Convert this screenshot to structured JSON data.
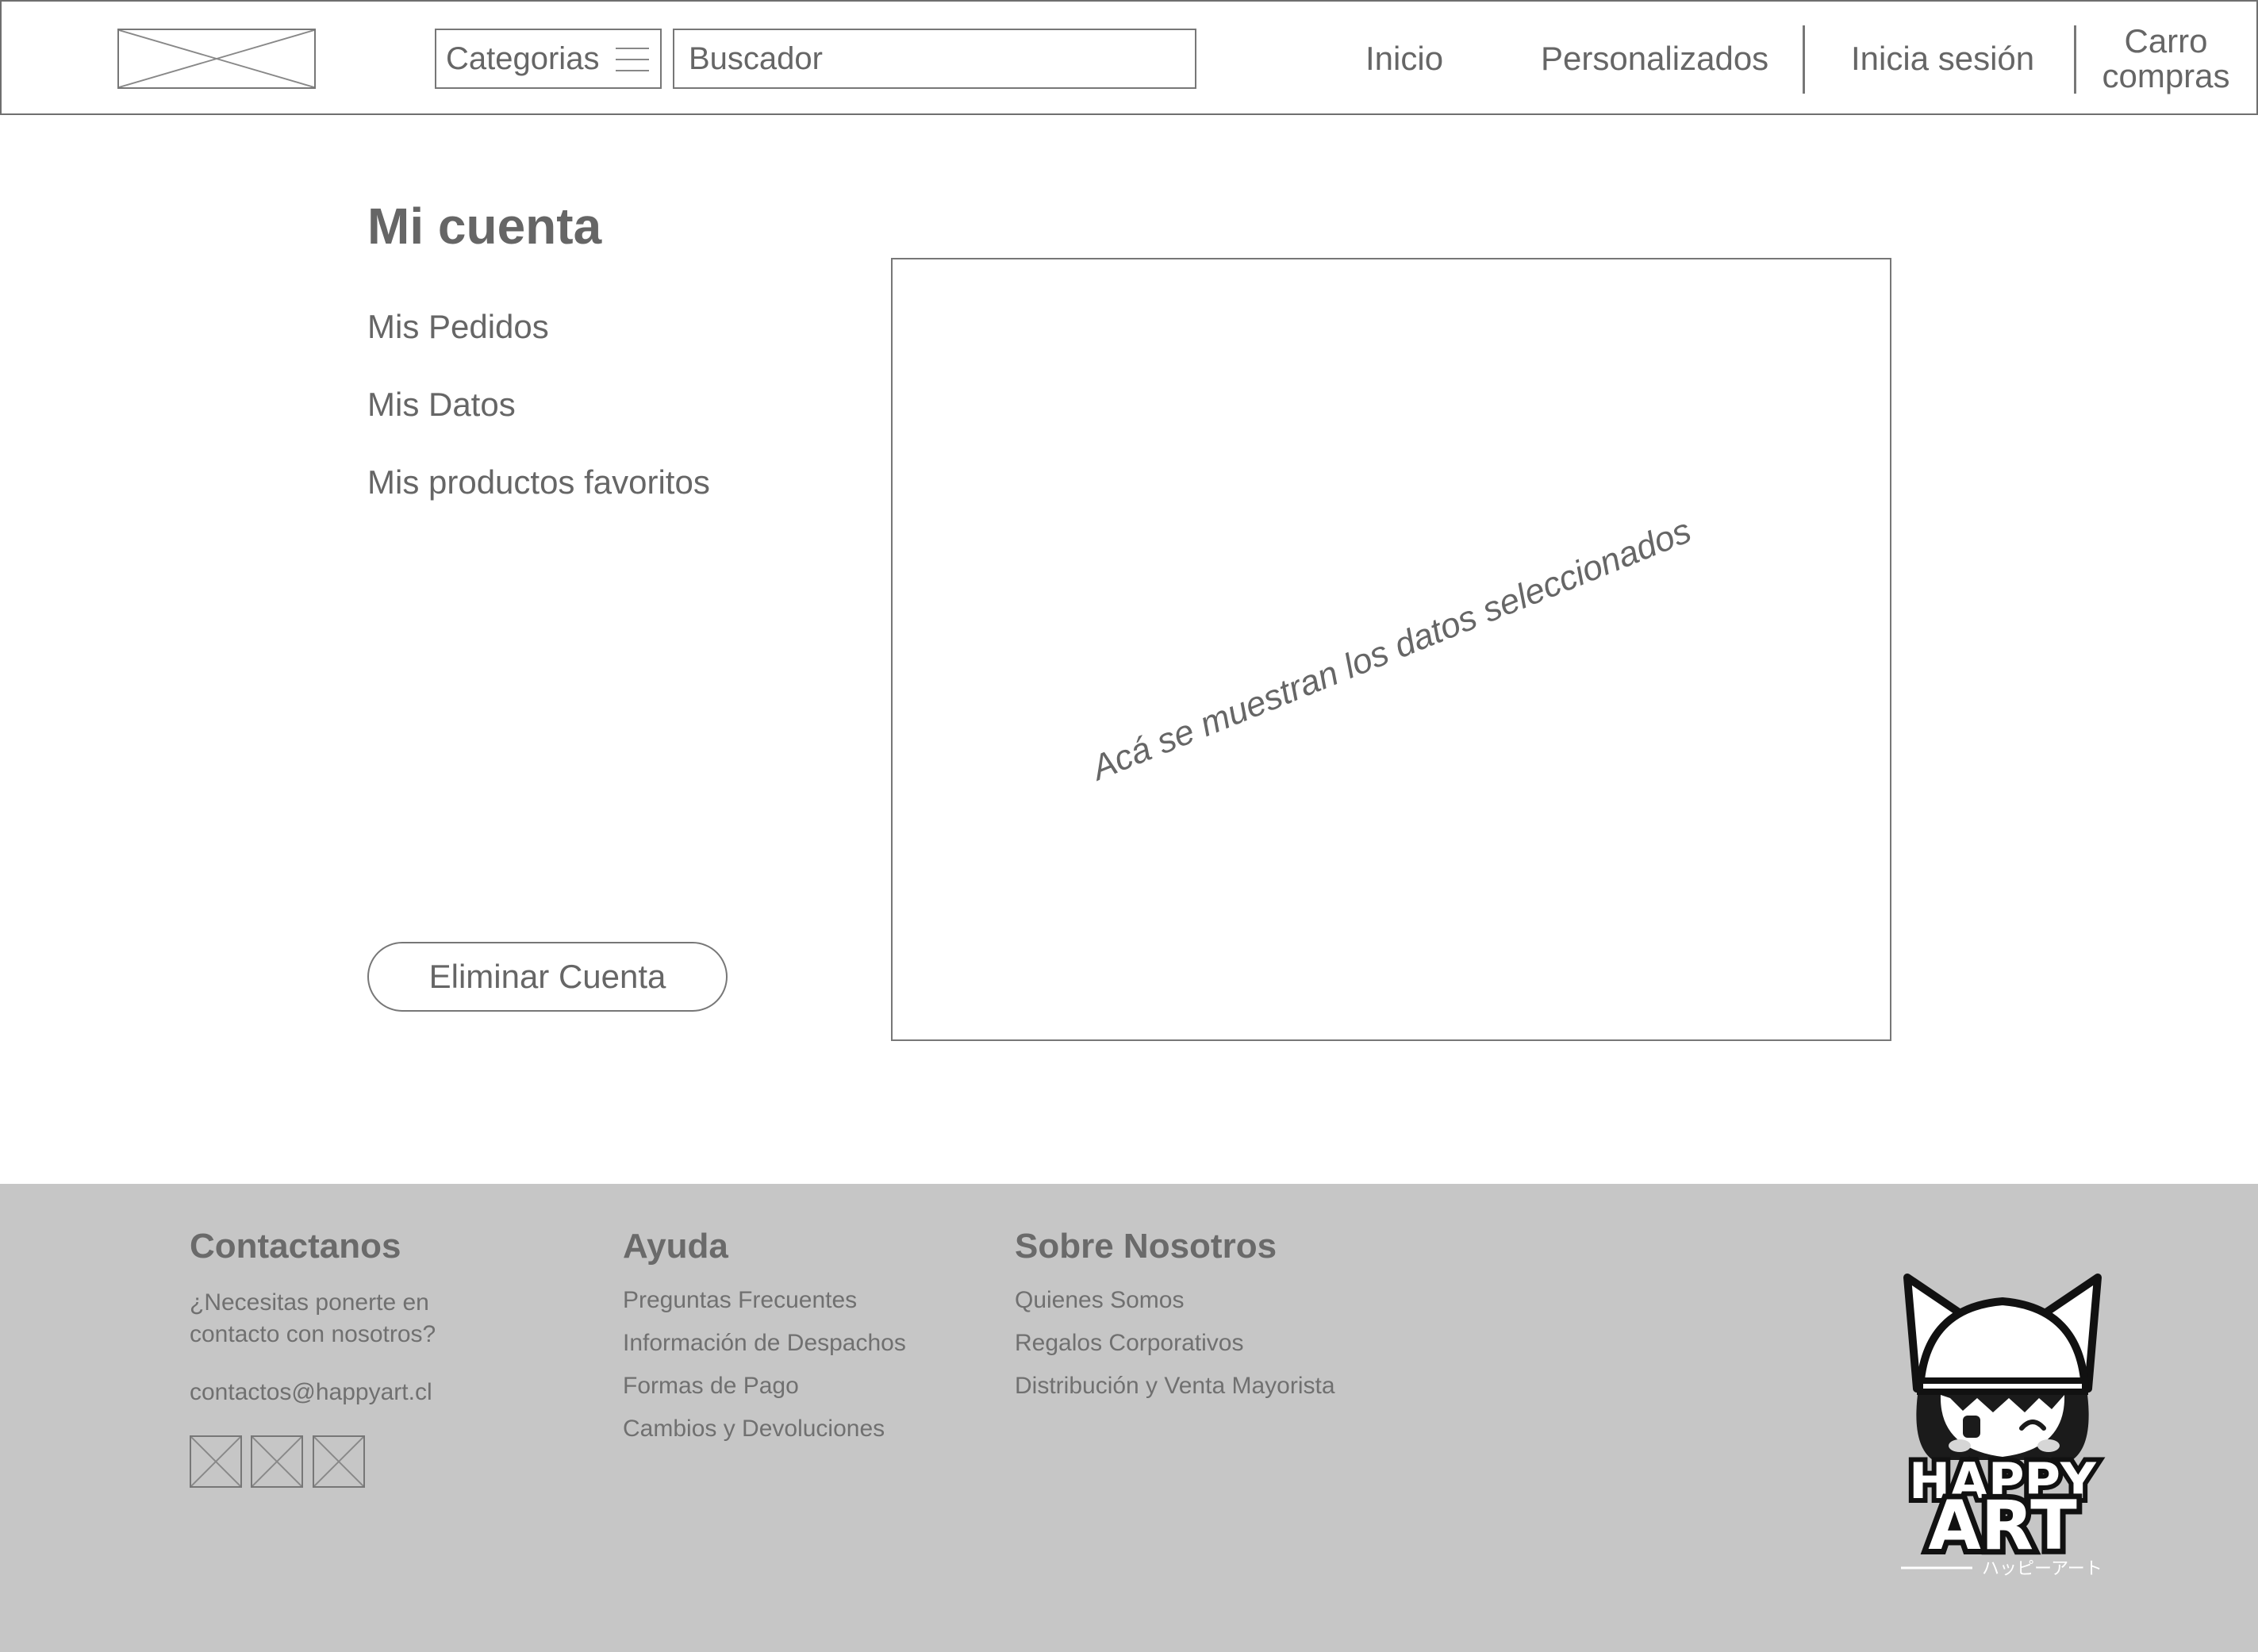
{
  "header": {
    "categories_label": "Categorias",
    "search_placeholder": "Buscador",
    "nav": {
      "home": "Inicio",
      "custom": "Personalizados",
      "login": "Inicia sesión",
      "cart_line1": "Carro",
      "cart_line2": "compras"
    }
  },
  "account": {
    "title": "Mi cuenta",
    "menu": [
      "Mis Pedidos",
      "Mis Datos",
      "Mis productos favoritos"
    ],
    "delete_button": "Eliminar Cuenta",
    "panel_note": "Acá se muestran los datos seleccionados"
  },
  "footer": {
    "contact": {
      "title": "Contactanos",
      "text": "¿Necesitas ponerte en contacto con nosotros?",
      "email": "contactos@happyart.cl"
    },
    "help": {
      "title": "Ayuda",
      "links": [
        "Preguntas Frecuentes",
        "Información de Despachos",
        "Formas de Pago",
        "Cambios y Devoluciones"
      ]
    },
    "about": {
      "title": "Sobre Nosotros",
      "links": [
        "Quienes Somos",
        "Regalos Corporativos",
        "Distribución y Venta Mayorista"
      ]
    },
    "brand": {
      "logo_line1": "HAPPY",
      "logo_line2": "ART",
      "logo_kana": "ハッピーアート"
    }
  },
  "icons": {
    "logo_placeholder": "image-placeholder-icon",
    "categories": "hamburger-icon",
    "social": [
      "social-placeholder-icon",
      "social-placeholder-icon",
      "social-placeholder-icon"
    ]
  },
  "colors": {
    "text": "#666666",
    "border": "#777777",
    "footer_bg": "#c6c6c6"
  }
}
